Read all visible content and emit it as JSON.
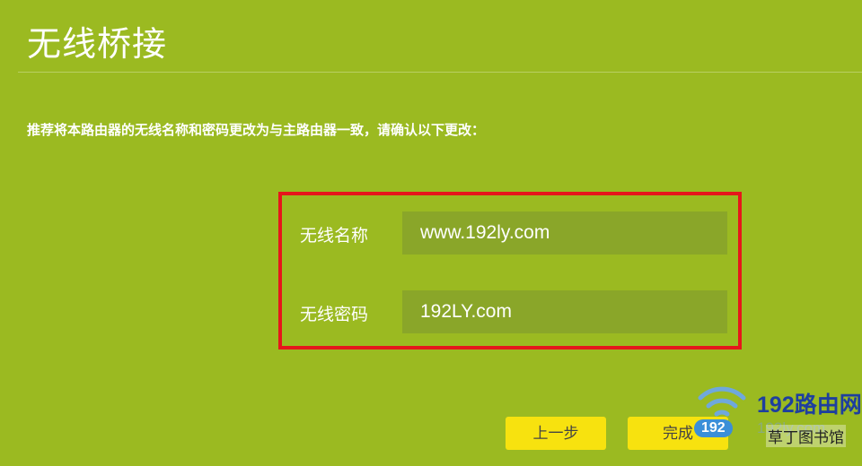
{
  "page": {
    "title": "无线桥接",
    "notice": "推荐将本路由器的无线名称和密码更改为与主路由器一致，请确认以下更改："
  },
  "form": {
    "ssid_label": "无线名称",
    "ssid_value": "www.192ly.com",
    "password_label": "无线密码",
    "password_value": "192LY.com"
  },
  "buttons": {
    "prev_label": "上一步",
    "finish_label": "完成"
  },
  "watermark": {
    "brand": "192路由网",
    "number": "192",
    "faint_text": "192ly.com",
    "site": "草丁图书馆",
    "icon": "wifi-icon"
  },
  "colors": {
    "background": "#9bba21",
    "input_background": "#8aa629",
    "highlight_border": "#e6161b",
    "button": "#f7e20f"
  }
}
